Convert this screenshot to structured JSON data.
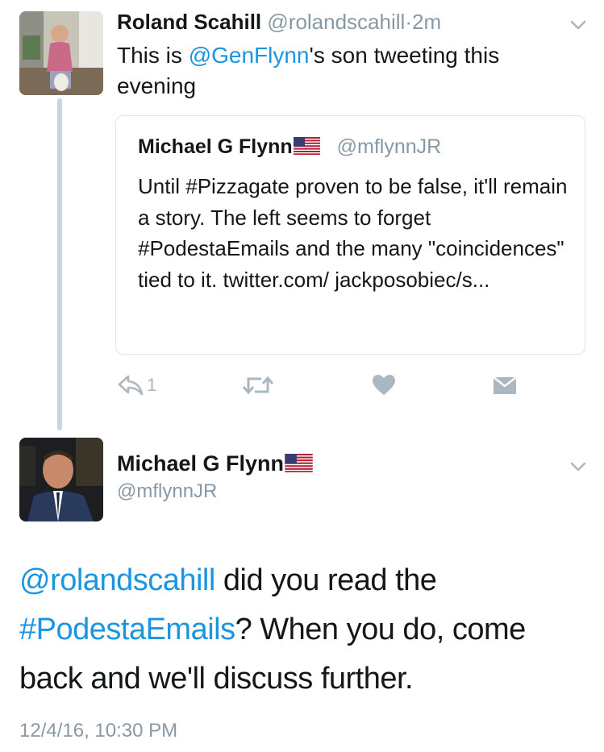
{
  "tweet1": {
    "author_name": "Roland Scahill",
    "author_handle": "@rolandscahill",
    "separator": "·",
    "time": "2m",
    "text_prefix": "This is ",
    "text_mention": "@GenFlynn",
    "text_suffix": "'s son tweeting this evening",
    "avatar": "person-with-dog-photo"
  },
  "quoted_tweet": {
    "author_name": "Michael G Flynn",
    "flag": "us-flag-icon",
    "author_handle": "@mflynnJR",
    "text": "Until #Pizzagate proven to be false, it'll remain a story. The left seems to forget #PodestaEmails and the many \"coincidences\" tied to it. twitter.com/ jackposobiec/s..."
  },
  "actions": {
    "reply_count": "1",
    "icons": [
      "reply-icon",
      "retweet-icon",
      "like-icon",
      "message-icon"
    ]
  },
  "tweet2": {
    "author_name": "Michael G Flynn",
    "flag": "us-flag-icon",
    "author_handle": "@mflynnJR",
    "text_mention": "@rolandscahill",
    "text_part1": " did you read the ",
    "text_hashtag": "#PodestaEmails",
    "text_part2": "? When you do, come back and we'll discuss further.",
    "timestamp": "12/4/16, 10:30 PM",
    "avatar": "man-in-suit-photo"
  },
  "colors": {
    "link": "#1b95e0",
    "secondary_text": "#8899a6",
    "icon": "#aab8c2",
    "thread_line": "#ccd6dd",
    "border": "#dfe4e8"
  }
}
